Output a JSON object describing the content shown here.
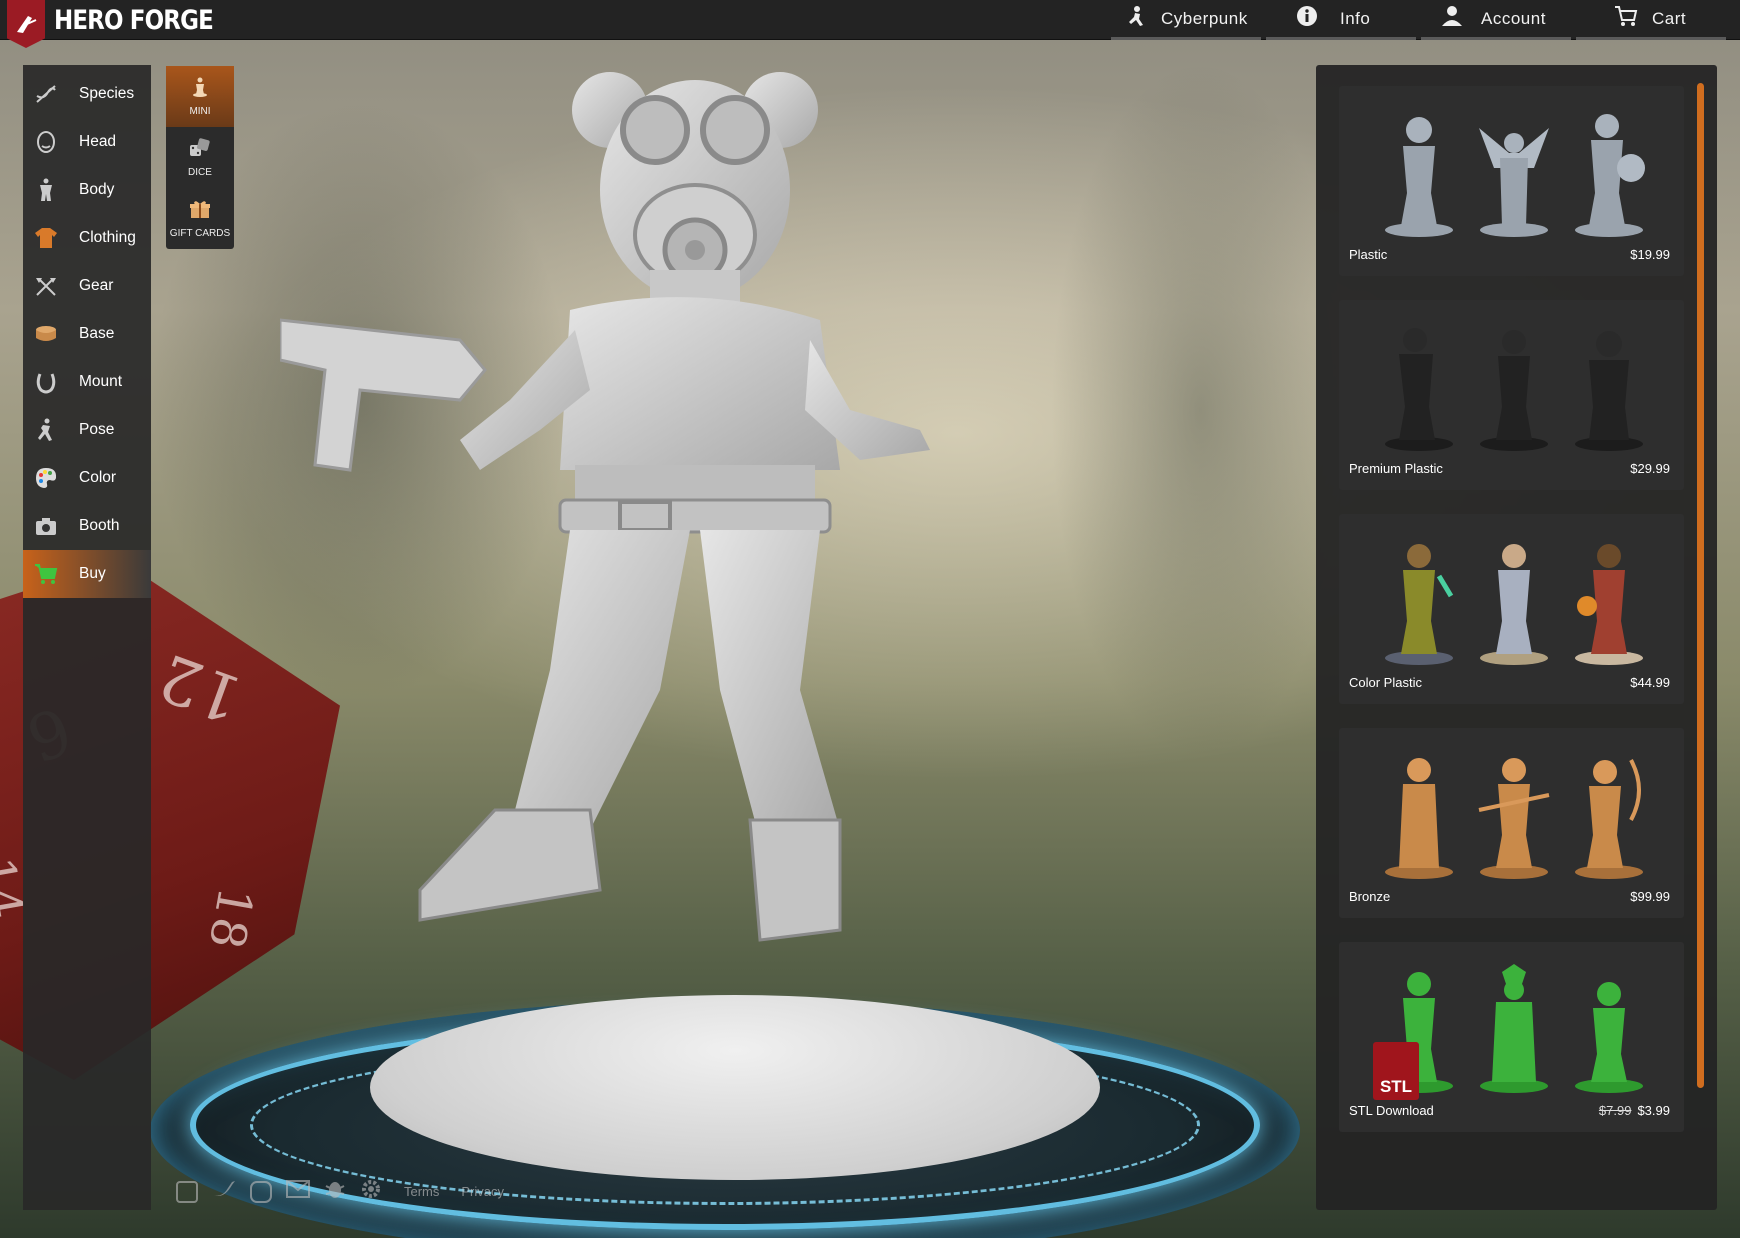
{
  "app": {
    "brand": "HERO FORGE"
  },
  "topnav": [
    {
      "label": "Cyberpunk",
      "icon": "kneeling-figure-icon"
    },
    {
      "label": "Info",
      "icon": "info-icon"
    },
    {
      "label": "Account",
      "icon": "user-icon"
    },
    {
      "label": "Cart",
      "icon": "cart-icon"
    }
  ],
  "menu": [
    {
      "label": "Species",
      "icon": "dna-icon"
    },
    {
      "label": "Head",
      "icon": "head-icon"
    },
    {
      "label": "Body",
      "icon": "body-icon"
    },
    {
      "label": "Clothing",
      "icon": "shirt-icon"
    },
    {
      "label": "Gear",
      "icon": "axes-icon"
    },
    {
      "label": "Base",
      "icon": "base-icon"
    },
    {
      "label": "Mount",
      "icon": "horseshoe-icon"
    },
    {
      "label": "Pose",
      "icon": "pose-icon"
    },
    {
      "label": "Color",
      "icon": "palette-icon"
    },
    {
      "label": "Booth",
      "icon": "camera-icon"
    },
    {
      "label": "Buy",
      "icon": "cart-icon",
      "active": true
    }
  ],
  "typetabs": [
    {
      "label": "MINI",
      "icon": "mini-figure-icon",
      "active": true
    },
    {
      "label": "DICE",
      "icon": "dice-icon"
    },
    {
      "label": "GIFT CARDS",
      "icon": "gift-icon"
    }
  ],
  "products": [
    {
      "name": "Plastic",
      "price": "$19.99",
      "color": "#9aa3ad"
    },
    {
      "name": "Premium Plastic",
      "price": "$29.99",
      "color": "#222222"
    },
    {
      "name": "Color Plastic",
      "price": "$44.99",
      "color": "#b09040"
    },
    {
      "name": "Bronze",
      "price": "$99.99",
      "color": "#c98a4a"
    },
    {
      "name": "STL Download",
      "old_price": "$7.99",
      "price": "$3.99",
      "color": "#3cb23c",
      "badge": "STL"
    }
  ],
  "footer": {
    "terms": "Terms",
    "privacy": "Privacy"
  },
  "colors": {
    "accent": "#d06d1f",
    "brand": "#9b1b24",
    "buy_icon": "#3fc43f"
  }
}
